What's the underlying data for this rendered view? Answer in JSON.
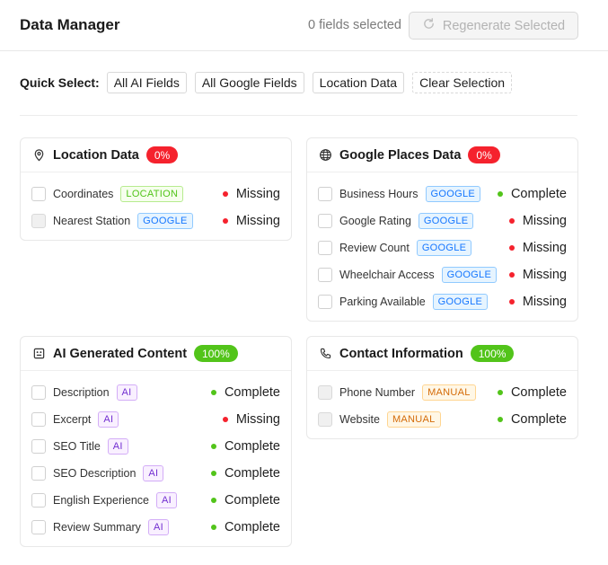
{
  "header": {
    "title": "Data Manager",
    "selected_count": "0 fields selected",
    "regenerate_label": "Regenerate Selected"
  },
  "quick_select": {
    "label": "Quick Select:",
    "buttons": [
      "All AI Fields",
      "All Google Fields",
      "Location Data",
      "Clear Selection"
    ]
  },
  "colors": {
    "missing": "#f5222d",
    "complete": "#52c41a",
    "tag_location": "#52c41a",
    "tag_google": "#1677ff",
    "tag_ai": "#722ed1",
    "tag_manual": "#d46b08"
  },
  "cards": [
    {
      "title": "Location Data",
      "icon": "map-pin-icon",
      "percent": "0%",
      "fields": [
        {
          "name": "Coordinates",
          "tag": "LOCATION",
          "status": "Missing"
        },
        {
          "name": "Nearest Station",
          "tag": "GOOGLE",
          "status": "Missing",
          "disabled": true
        }
      ]
    },
    {
      "title": "Google Places Data",
      "icon": "globe-icon",
      "percent": "0%",
      "fields": [
        {
          "name": "Business Hours",
          "tag": "GOOGLE",
          "status": "Complete"
        },
        {
          "name": "Google Rating",
          "tag": "GOOGLE",
          "status": "Missing"
        },
        {
          "name": "Review Count",
          "tag": "GOOGLE",
          "status": "Missing"
        },
        {
          "name": "Wheelchair Access",
          "tag": "GOOGLE",
          "status": "Missing"
        },
        {
          "name": "Parking Available",
          "tag": "GOOGLE",
          "status": "Missing"
        }
      ]
    },
    {
      "title": "AI Generated Content",
      "icon": "robot-icon",
      "percent": "100%",
      "fields": [
        {
          "name": "Description",
          "tag": "AI",
          "status": "Complete"
        },
        {
          "name": "Excerpt",
          "tag": "AI",
          "status": "Missing"
        },
        {
          "name": "SEO Title",
          "tag": "AI",
          "status": "Complete"
        },
        {
          "name": "SEO Description",
          "tag": "AI",
          "status": "Complete"
        },
        {
          "name": "English Experience",
          "tag": "AI",
          "status": "Complete"
        },
        {
          "name": "Review Summary",
          "tag": "AI",
          "status": "Complete"
        }
      ]
    },
    {
      "title": "Contact Information",
      "icon": "phone-icon",
      "percent": "100%",
      "fields": [
        {
          "name": "Phone Number",
          "tag": "MANUAL",
          "status": "Complete",
          "disabled": true
        },
        {
          "name": "Website",
          "tag": "MANUAL",
          "status": "Complete",
          "disabled": true
        }
      ]
    }
  ]
}
